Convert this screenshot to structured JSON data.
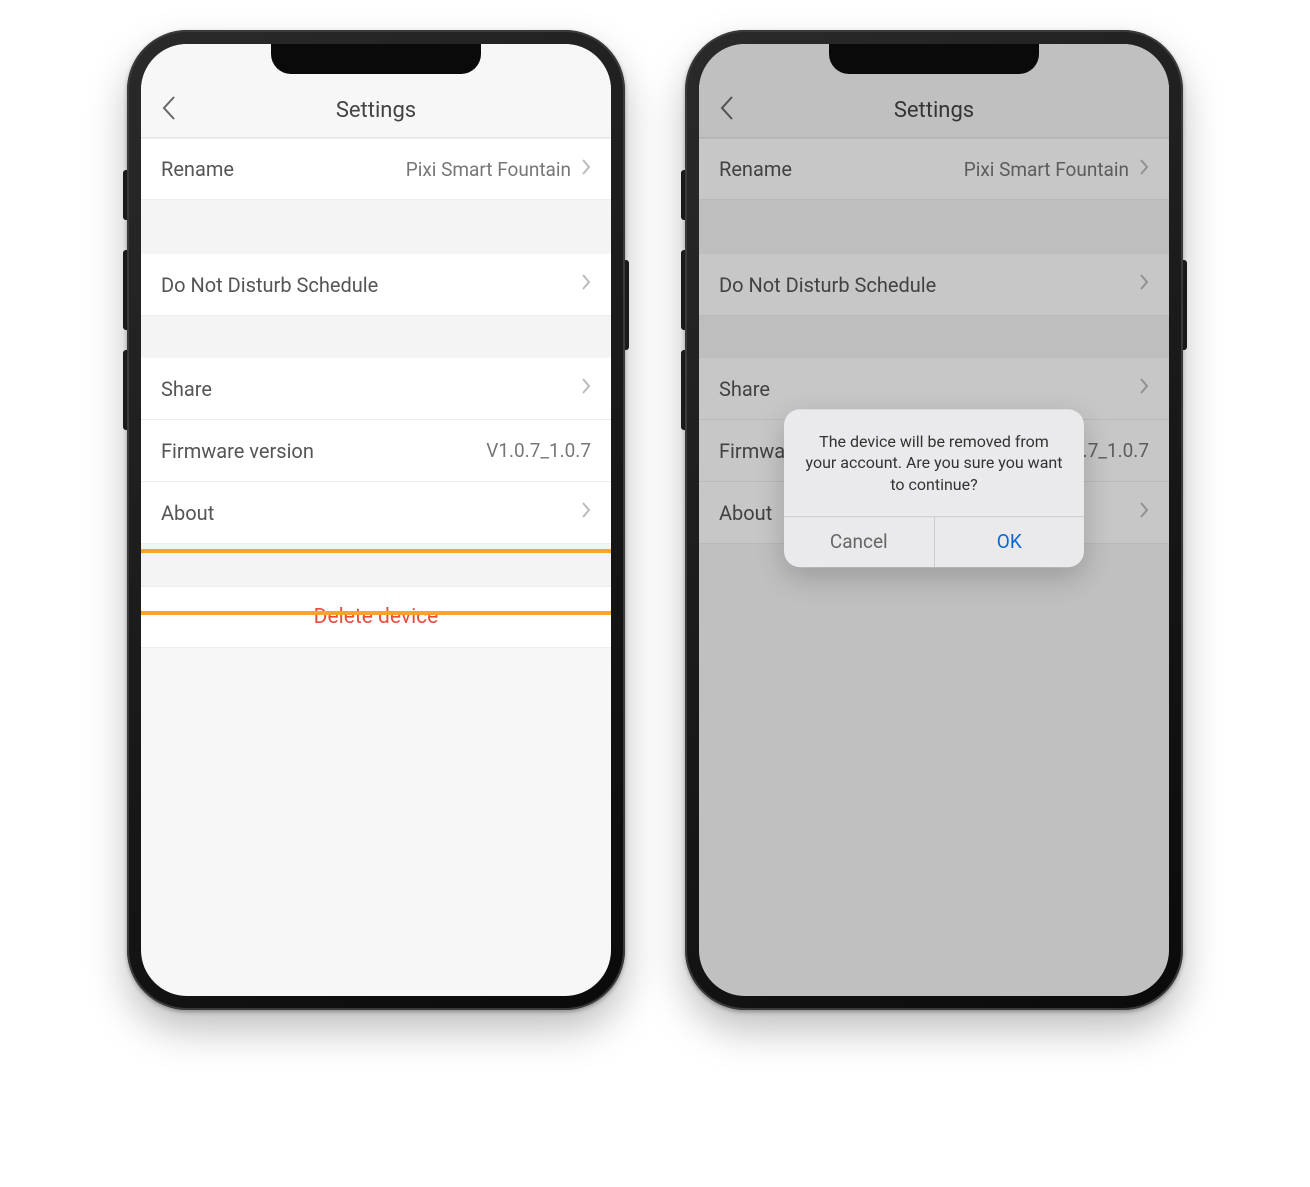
{
  "phone1": {
    "header": {
      "title": "Settings"
    },
    "rows": {
      "rename": {
        "label": "Rename",
        "value": "Pixi Smart Fountain"
      },
      "dnd": {
        "label": "Do Not Disturb Schedule"
      },
      "share": {
        "label": "Share"
      },
      "firmware": {
        "label": "Firmware version",
        "value": "V1.0.7_1.0.7"
      },
      "about": {
        "label": "About"
      }
    },
    "delete_label": "Delete device"
  },
  "phone2": {
    "header": {
      "title": "Settings"
    },
    "rows": {
      "rename": {
        "label": "Rename",
        "value": "Pixi Smart Fountain"
      },
      "dnd": {
        "label": "Do Not Disturb Schedule"
      },
      "share": {
        "label": "Share"
      },
      "firmware": {
        "label": "Firmware version",
        "value": "V1.0.7_1.0.7"
      },
      "about": {
        "label": "About"
      }
    },
    "dialog": {
      "message": "The device will be removed from your account. Are you sure you want to continue?",
      "cancel": "Cancel",
      "ok": "OK"
    }
  },
  "colors": {
    "highlight": "#f5a623",
    "delete_text": "#e74c3c",
    "ok_text": "#0b67d0"
  }
}
